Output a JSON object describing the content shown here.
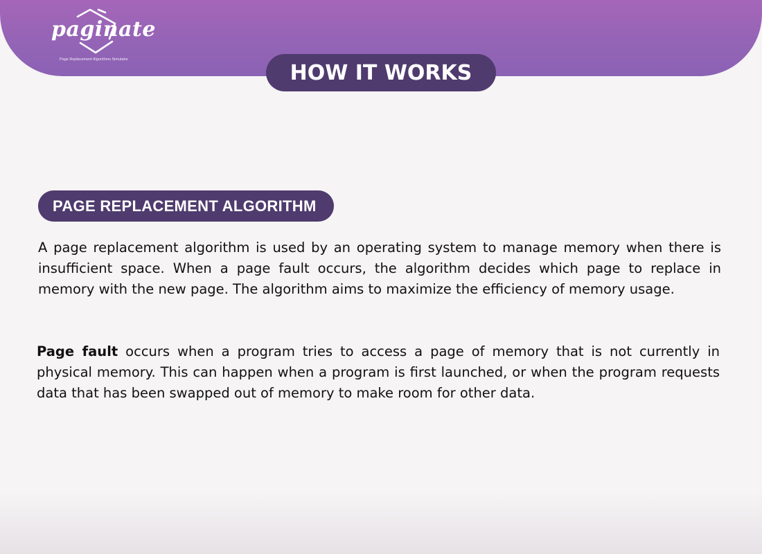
{
  "brand": {
    "wordmark": "paginate",
    "tagline": "Page Replacement Algorithms Simulator"
  },
  "header": {
    "title": "HOW IT WORKS"
  },
  "section": {
    "heading": "PAGE REPLACEMENT ALGORITHM",
    "paragraph_1": "A page replacement algorithm is used by an operating system to manage memory when there is insufficient space. When a page fault occurs, the algorithm decides which page to replace in memory with the new page. The algorithm aims to maximize the efficiency of memory usage.",
    "paragraph_2_term": "Page fault",
    "paragraph_2_rest": " occurs when a program tries to access a page of memory that is not currently in physical memory. This can happen when a program is first launched, or when the program requests data that has been swapped out of memory to make room for other data."
  },
  "colors": {
    "banner_top": "#a566b8",
    "banner_bottom": "#8b62b4",
    "pill": "#4f3b6e",
    "background": "#f6f4f5",
    "text": "#111111"
  },
  "icons": {
    "logo": "paper-sheets-icon"
  }
}
